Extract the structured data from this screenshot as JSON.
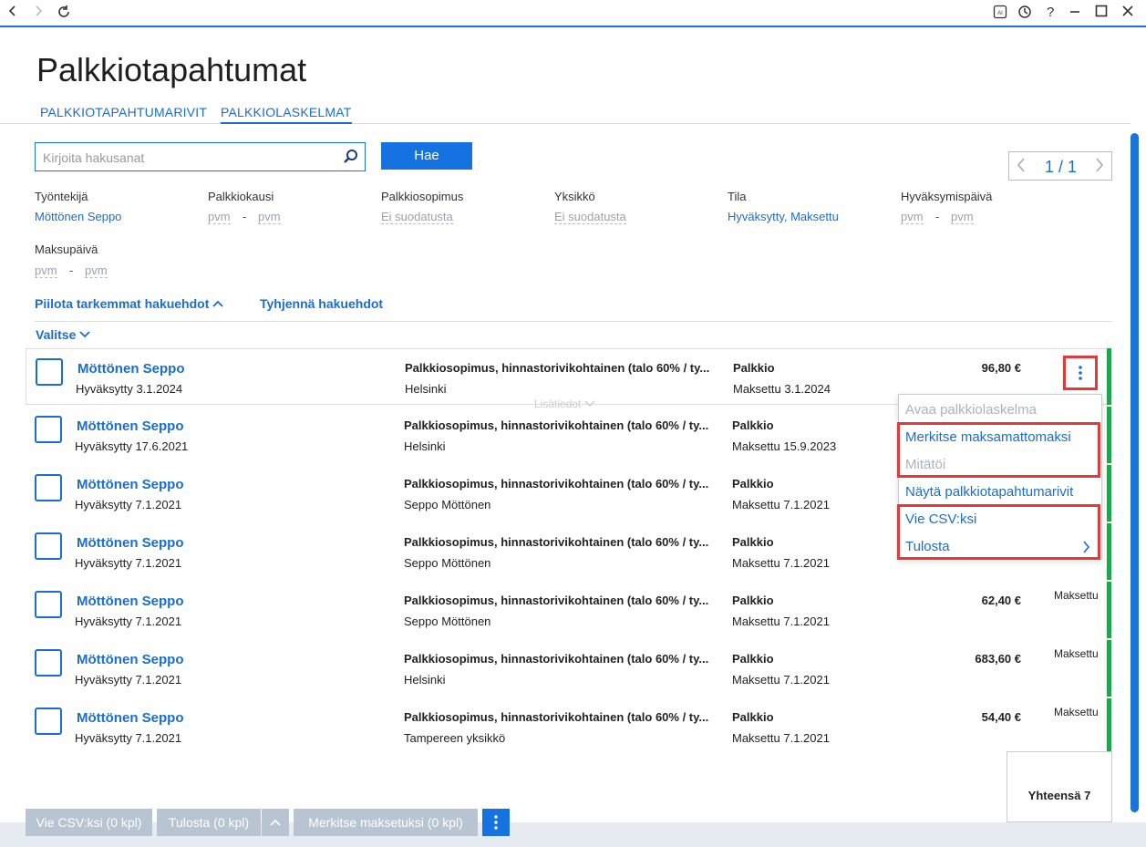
{
  "titlebar": {
    "back_icon": "chevron-left",
    "forward_icon": "chevron-right",
    "refresh_icon": "refresh",
    "ai_icon": "AI",
    "history_icon": "clock",
    "help": "?",
    "minimize": "—",
    "maximize": "☐",
    "close": "✕"
  },
  "page_title": "Palkkiotapahtumat",
  "tabs": [
    {
      "label": "PALKKIOTAPAHTUMARIVIT"
    },
    {
      "label": "PALKKIOLASKELMAT",
      "active": true
    }
  ],
  "search": {
    "placeholder": "Kirjoita hakusanat",
    "button": "Hae"
  },
  "pager": {
    "text": "1 / 1"
  },
  "filters": {
    "employee": {
      "label": "Työntekijä",
      "value": "Möttönen Seppo"
    },
    "period": {
      "label": "Palkkiokausi",
      "from": "pvm",
      "to": "pvm"
    },
    "agreement": {
      "label": "Palkkiosopimus",
      "value": "Ei suodatusta"
    },
    "unit": {
      "label": "Yksikkö",
      "value": "Ei suodatusta"
    },
    "status": {
      "label": "Tila",
      "value": "Hyväksytty, Maksettu"
    },
    "approval_date": {
      "label": "Hyväksymispäivä",
      "from": "pvm",
      "to": "pvm"
    },
    "payment_date": {
      "label": "Maksupäivä",
      "from": "pvm",
      "to": "pvm"
    },
    "dash": "-"
  },
  "links": {
    "hide": "Piilota tarkemmat hakuehdot",
    "clear": "Tyhjennä hakuehdot",
    "select": "Valitse"
  },
  "rows": [
    {
      "name": "Möttönen Seppo",
      "approved": "Hyväksytty 3.1.2024",
      "agreement": "Palkkiosopimus, hinnastorivikohtainen (talo 60% / ty...",
      "unit": "Helsinki",
      "type": "Palkkio",
      "paid": "Maksettu 3.1.2024",
      "amount": "96,80 €",
      "status": ""
    },
    {
      "name": "Möttönen Seppo",
      "approved": "Hyväksytty 17.6.2021",
      "agreement": "Palkkiosopimus, hinnastorivikohtainen (talo 60% / ty...",
      "unit": "Helsinki",
      "type": "Palkkio",
      "paid": "Maksettu 15.9.2023",
      "amount": "",
      "status": ""
    },
    {
      "name": "Möttönen Seppo",
      "approved": "Hyväksytty 7.1.2021",
      "agreement": "Palkkiosopimus, hinnastorivikohtainen (talo 60% / ty...",
      "unit": "Seppo Möttönen",
      "type": "Palkkio",
      "paid": "Maksettu 7.1.2021",
      "amount": "",
      "status": ""
    },
    {
      "name": "Möttönen Seppo",
      "approved": "Hyväksytty 7.1.2021",
      "agreement": "Palkkiosopimus, hinnastorivikohtainen (talo 60% / ty...",
      "unit": "Seppo Möttönen",
      "type": "Palkkio",
      "paid": "Maksettu 7.1.2021",
      "amount": "",
      "status": ""
    },
    {
      "name": "Möttönen Seppo",
      "approved": "Hyväksytty 7.1.2021",
      "agreement": "Palkkiosopimus, hinnastorivikohtainen (talo 60% / ty...",
      "unit": "Seppo Möttönen",
      "type": "Palkkio",
      "paid": "Maksettu 7.1.2021",
      "amount": "62,40 €",
      "status": "Maksettu"
    },
    {
      "name": "Möttönen Seppo",
      "approved": "Hyväksytty 7.1.2021",
      "agreement": "Palkkiosopimus, hinnastorivikohtainen (talo 60% / ty...",
      "unit": "Helsinki",
      "type": "Palkkio",
      "paid": "Maksettu 7.1.2021",
      "amount": "683,60 €",
      "status": "Maksettu"
    },
    {
      "name": "Möttönen Seppo",
      "approved": "Hyväksytty 7.1.2021",
      "agreement": "Palkkiosopimus, hinnastorivikohtainen (talo 60% / ty...",
      "unit": "Tampereen yksikkö",
      "type": "Palkkio",
      "paid": "Maksettu 7.1.2021",
      "amount": "54,40 €",
      "status": "Maksettu"
    }
  ],
  "details_label": "Lisätiedot",
  "context_menu": {
    "open": "Avaa palkkiolaskelma",
    "mark_unpaid": "Merkitse maksamattomaksi",
    "cancel": "Mitätöi",
    "show_rows": "Näytä palkkiotapahtumarivit",
    "export_csv": "Vie CSV:ksi",
    "print": "Tulosta"
  },
  "total": "Yhteensä 7",
  "bottom_bar": {
    "export": "Vie CSV:ksi (0 kpl)",
    "print": "Tulosta (0 kpl)",
    "mark_paid": "Merkitse maksetuksi (0 kpl)"
  },
  "colors": {
    "accent": "#1a73d9",
    "paid_bar": "#1fa64a",
    "highlight": "#e03a3a",
    "disabled_button": "#b8c4d1"
  }
}
